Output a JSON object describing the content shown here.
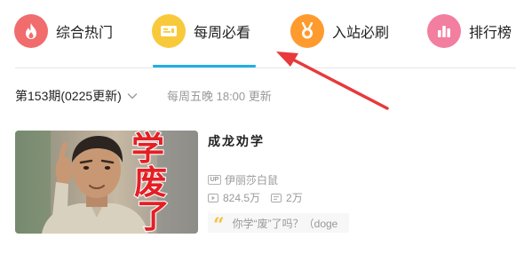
{
  "tabs": [
    {
      "label": "综合热门",
      "icon": "flame-icon",
      "color": "#f16c6c"
    },
    {
      "label": "每周必看",
      "icon": "ticket-icon",
      "color": "#f8c93b",
      "active": true
    },
    {
      "label": "入站必刷",
      "icon": "medal-icon",
      "color": "#ff9a2e"
    },
    {
      "label": "排行榜",
      "icon": "bar-chart-icon",
      "color": "#f27ea0"
    }
  ],
  "accent_color": "#23aee5",
  "period": {
    "selector_label": "第153期(0225更新)",
    "schedule": "每周五晚 18:00 更新"
  },
  "video": {
    "thumbnail_caption": [
      "学",
      "废",
      "了"
    ],
    "title": "成龙劝学",
    "uploader": "伊丽莎白鼠",
    "up_badge": "UP",
    "views": "824.5万",
    "danmaku": "2万",
    "quote": "你学“废”了吗？（doge"
  },
  "annotation": {
    "color": "#e8393b"
  }
}
